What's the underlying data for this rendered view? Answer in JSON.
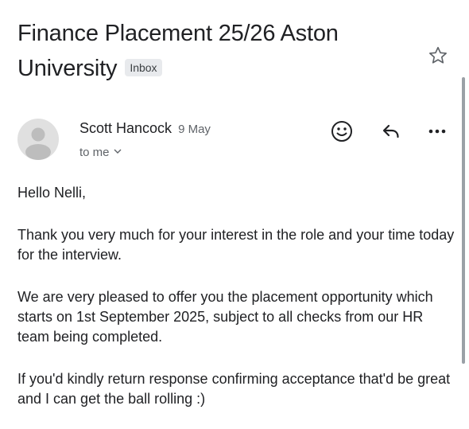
{
  "email": {
    "subject": "Finance Placement 25/26 Aston University",
    "label": "Inbox",
    "sender_name": "Scott Hancock",
    "date": "9 May",
    "recipient": "to me",
    "body": {
      "greeting": "Hello Nelli,",
      "p1": "Thank you very much for your interest in the role and your time today for the interview.",
      "p2": "We are very pleased to offer you the placement opportunity which starts on 1st September 2025, subject to all checks from our HR team being completed.",
      "p3": "If you'd kindly return response confirming acceptance that'd be great and I can get the ball rolling :)"
    }
  },
  "icons": {
    "star": "star-icon",
    "emoji": "emoji-icon",
    "reply": "reply-icon",
    "more": "more-vertical-icon",
    "avatar": "avatar-icon",
    "chevron": "chevron-down-icon"
  },
  "colors": {
    "text": "#202124",
    "secondary": "#5f6368",
    "badge_bg": "#e8eaed",
    "avatar_bg": "#e0e0e0"
  }
}
